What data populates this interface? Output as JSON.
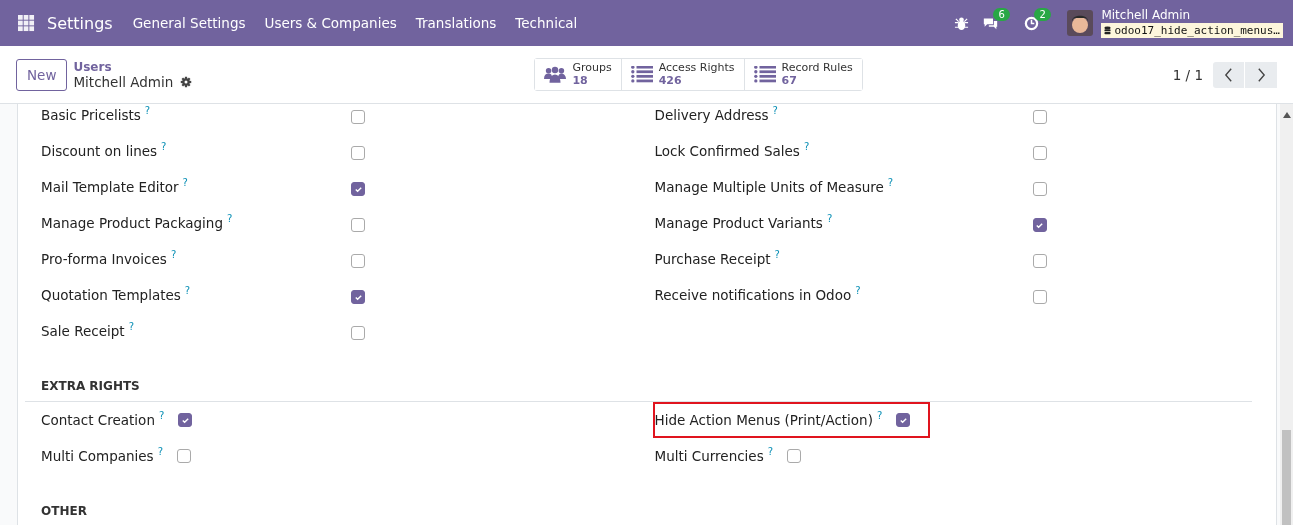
{
  "navbar": {
    "app_title": "Settings",
    "menus": [
      "General Settings",
      "Users & Companies",
      "Translations",
      "Technical"
    ],
    "messages_count": "6",
    "activities_count": "2",
    "user": {
      "name": "Mitchell Admin",
      "database": "odoo17_hide_action_menus…"
    }
  },
  "control_panel": {
    "new_button": "New",
    "breadcrumb_parent": "Users",
    "record_title": "Mitchell Admin",
    "stat_buttons": [
      {
        "kind": "groups",
        "label": "Groups",
        "value": "18"
      },
      {
        "kind": "list",
        "label": "Access Rights",
        "value": "426"
      },
      {
        "kind": "list",
        "label": "Record Rules",
        "value": "67"
      }
    ],
    "pager": "1 / 1"
  },
  "sections": [
    {
      "kind": "wide",
      "items": [
        {
          "label": "Basic Pricelists",
          "help": "?",
          "checked": false,
          "highlighted": false
        },
        {
          "label": "Delivery Address",
          "help": "?",
          "checked": false,
          "highlighted": false
        },
        {
          "label": "Discount on lines",
          "help": "?",
          "checked": false,
          "highlighted": false
        },
        {
          "label": "Lock Confirmed Sales",
          "help": "?",
          "checked": false,
          "highlighted": false
        },
        {
          "label": "Mail Template Editor",
          "help": "?",
          "checked": true,
          "highlighted": false
        },
        {
          "label": "Manage Multiple Units of Measure",
          "help": "?",
          "checked": false,
          "highlighted": false
        },
        {
          "label": "Manage Product Packaging",
          "help": "?",
          "checked": false,
          "highlighted": false
        },
        {
          "label": "Manage Product Variants",
          "help": "?",
          "checked": true,
          "highlighted": false
        },
        {
          "label": "Pro-forma Invoices",
          "help": "?",
          "checked": false,
          "highlighted": false
        },
        {
          "label": "Purchase Receipt",
          "help": "?",
          "checked": false,
          "highlighted": false
        },
        {
          "label": "Quotation Templates",
          "help": "?",
          "checked": true,
          "highlighted": false
        },
        {
          "label": "Receive notifications in Odoo",
          "help": "?",
          "checked": false,
          "highlighted": false
        },
        {
          "label": "Sale Receipt",
          "help": "?",
          "checked": false,
          "highlighted": false
        }
      ]
    },
    {
      "kind": "compact",
      "title": "EXTRA RIGHTS",
      "items": [
        {
          "label": "Contact Creation",
          "help": "?",
          "checked": true,
          "highlighted": false
        },
        {
          "label": "Hide Action Menus (Print/Action)",
          "help": "?",
          "checked": true,
          "highlighted": true
        },
        {
          "label": "Multi Companies",
          "help": "?",
          "checked": false,
          "highlighted": false
        },
        {
          "label": "Multi Currencies",
          "help": "?",
          "checked": false,
          "highlighted": false
        }
      ]
    },
    {
      "title": "OTHER"
    }
  ]
}
